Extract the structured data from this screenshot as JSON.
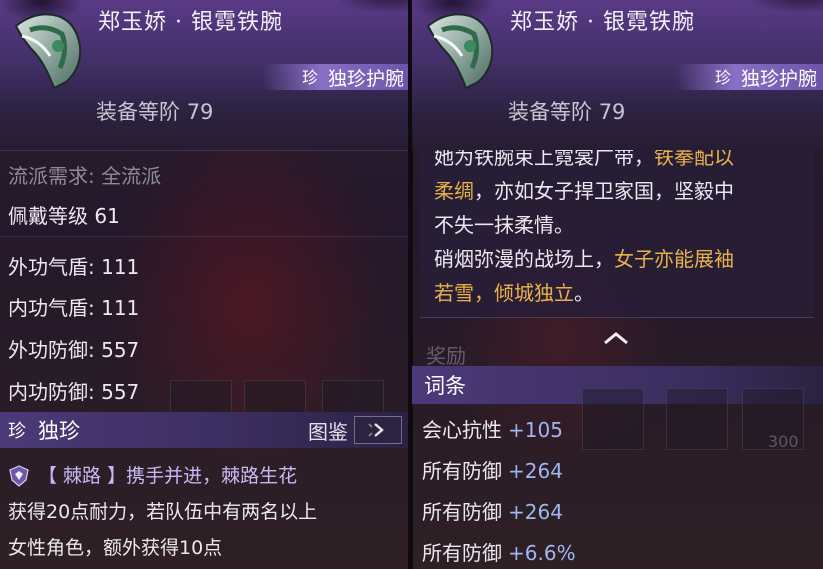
{
  "item": {
    "name": "郑玉娇 · 银霓铁腕",
    "rarity_label": "独珍护腕",
    "level_label": "装备等阶",
    "level_value": "79"
  },
  "left": {
    "school_req": "流派需求: 全流派",
    "wear_level": "佩戴等级 61",
    "stats": [
      "外功气盾: 111",
      "内功气盾: 111",
      "外功防御: 557",
      "内功防御: 557"
    ],
    "section_title": "独珍",
    "codex_label": "图鉴",
    "skill_name": "【 棘路 】携手并进，棘路生花",
    "skill_desc_1": "获得20点耐力，若队伍中有两名以上",
    "skill_desc_2": "女性角色，额外获得10点"
  },
  "right": {
    "lore_line_1a": "她为铁腕束上霓裳广带，",
    "lore_line_1b": "铁拳配以",
    "lore_line_2a": "柔绸",
    "lore_line_2b": "，亦如女子捍卫家国，坚毅中",
    "lore_line_3": "不失一抹柔情。",
    "lore_line_4a": "硝烟弥漫的战场上，",
    "lore_line_4b": "女子亦能展袖",
    "lore_line_5a": "若雪，倾城独立",
    "lore_line_5b": "。",
    "reward_label": "奖励",
    "terms_title": "词条",
    "ghost_count": "300",
    "attrs": [
      {
        "name": "会心抗性",
        "value": "+105"
      },
      {
        "name": "所有防御",
        "value": "+264"
      },
      {
        "name": "所有防御",
        "value": "+264"
      },
      {
        "name": "所有防御",
        "value": "+6.6%"
      }
    ]
  },
  "colors": {
    "highlight": "#e8b24a",
    "attr_value": "#9fb6f2",
    "header_purple": "#5a3a86"
  }
}
